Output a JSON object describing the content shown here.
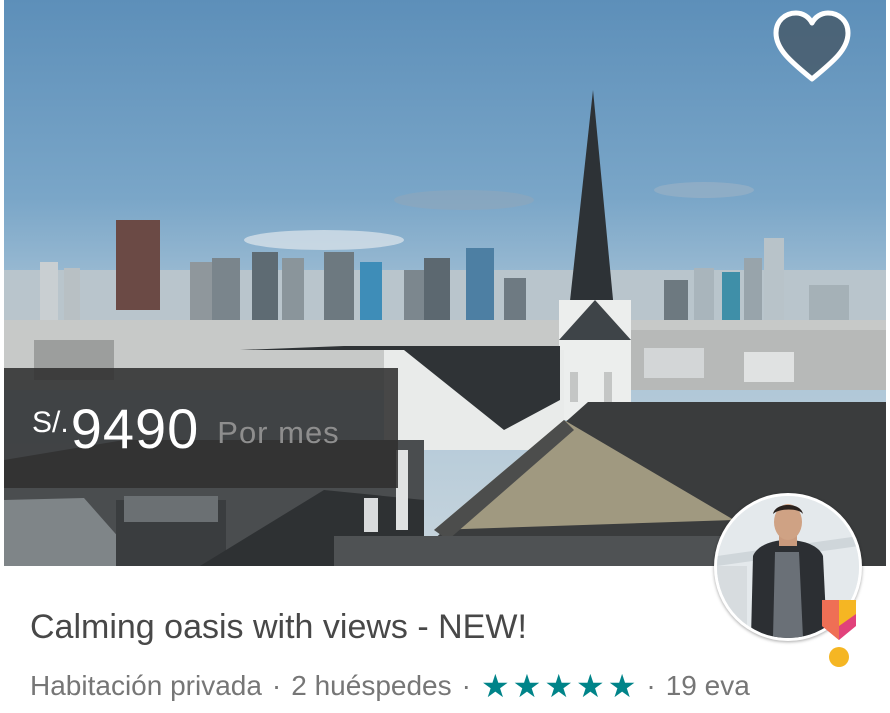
{
  "listing": {
    "price": {
      "currency": "S/.",
      "amount": "9490",
      "period": "Por mes"
    },
    "title": "Calming oasis with views - NEW!",
    "room_type": "Habitación privada",
    "guests": "2 huéspedes",
    "separator": "·",
    "rating_stars": 5,
    "rating_star_glyph": "★",
    "reviews": "19 eva",
    "is_favorite": false,
    "host_superhost": true
  },
  "colors": {
    "star": "#008489",
    "title": "#484848",
    "meta": "#767676",
    "price_overlay": "#303030",
    "superhost_pink": "#e1427b",
    "superhost_gold": "#f5b623"
  },
  "icons": {
    "favorite": "heart-icon",
    "superhost": "superhost-badge-icon",
    "rating": "star-icon"
  }
}
